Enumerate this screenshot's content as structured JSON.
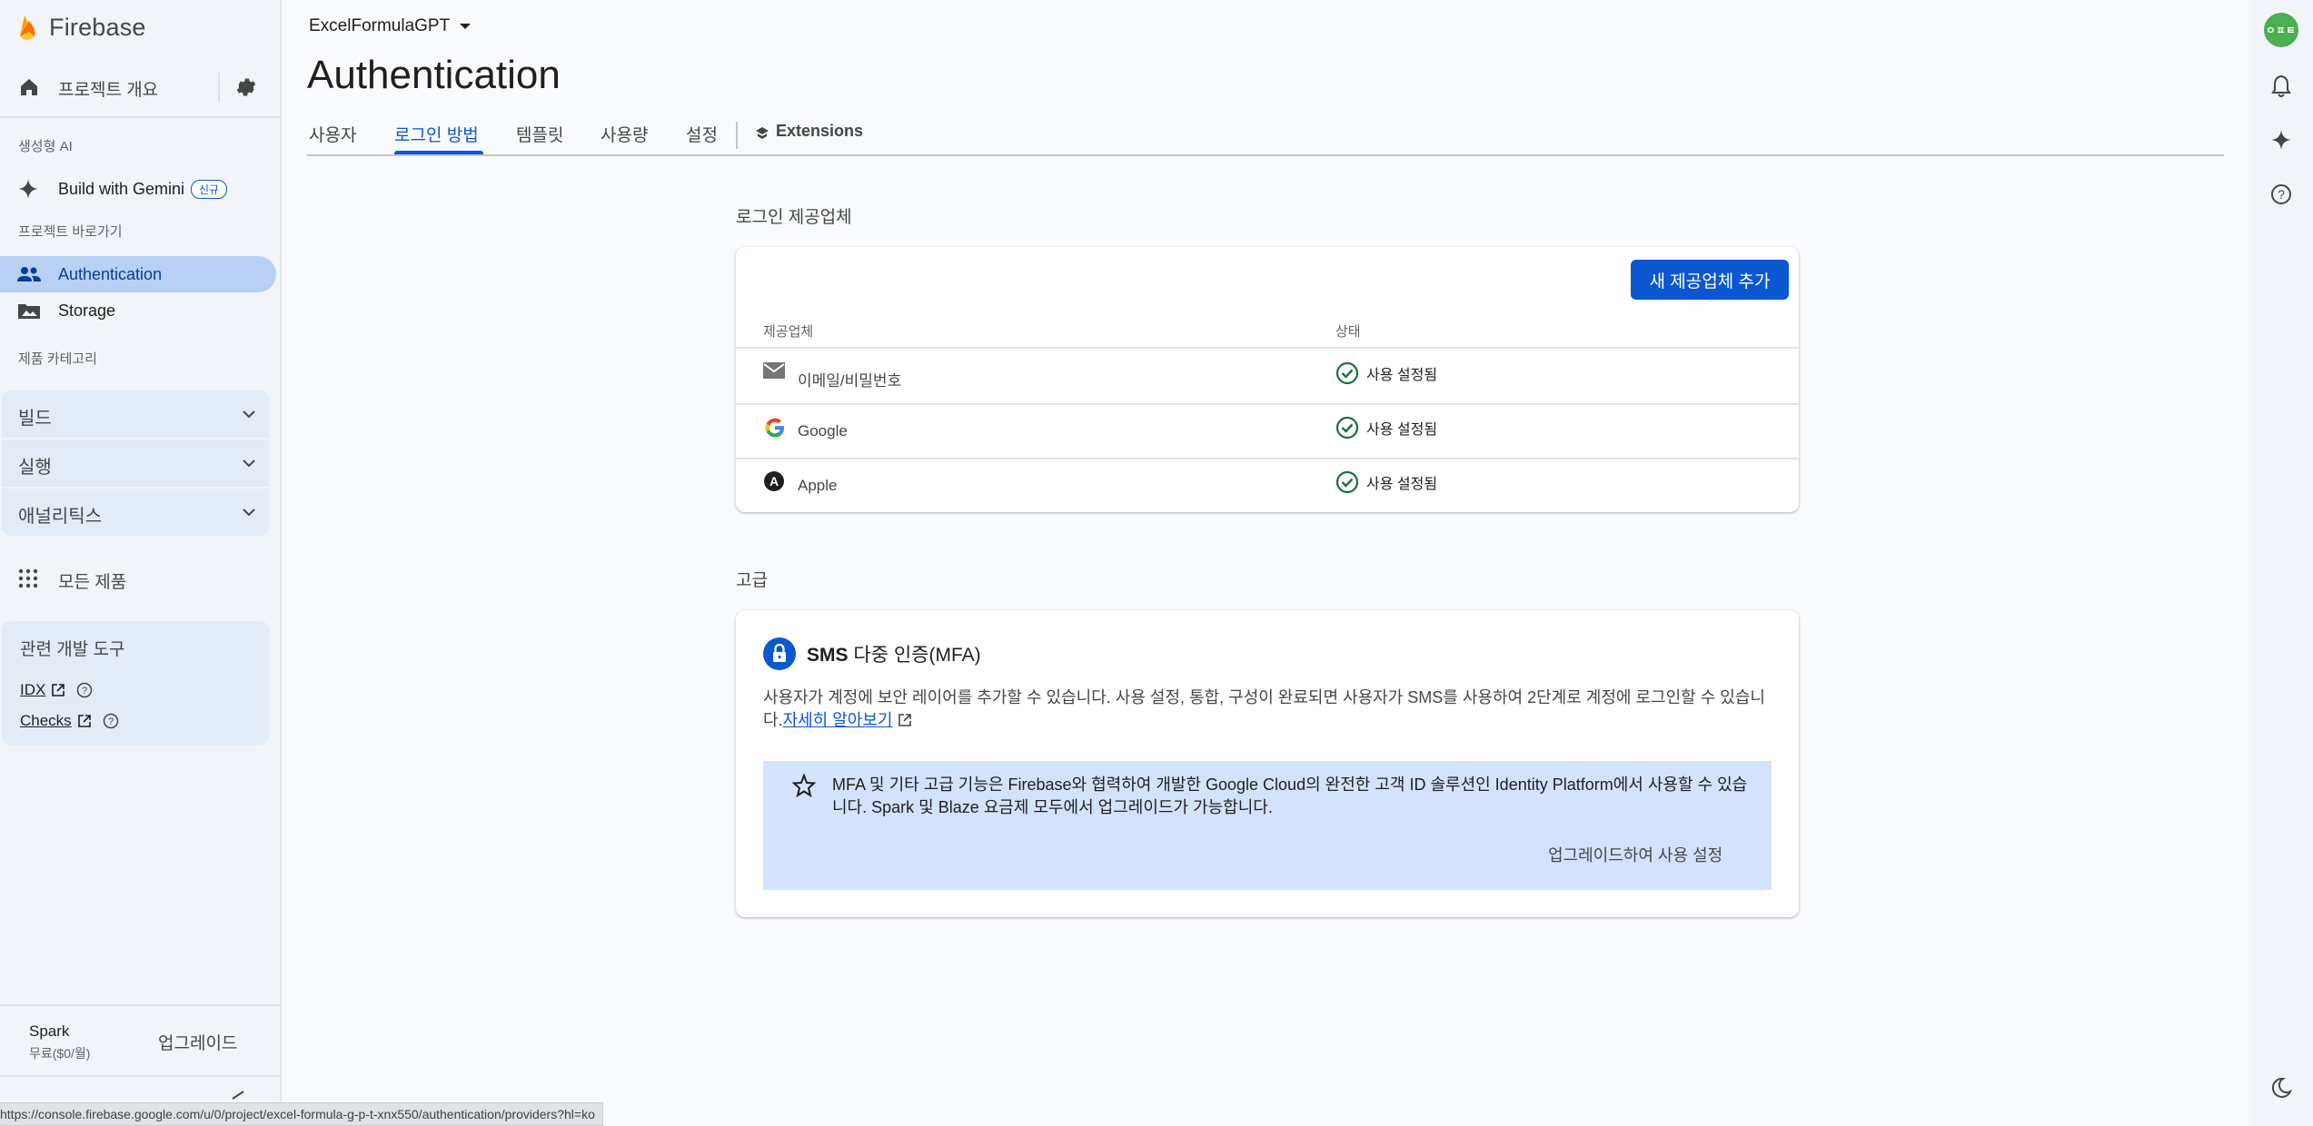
{
  "sidebar": {
    "brand": "Firebase",
    "overview": "프로젝트 개요",
    "section_genai": "생성형 AI",
    "gemini": {
      "label": "Build with Gemini",
      "badge": "신규"
    },
    "section_shortcuts": "프로젝트 바로가기",
    "shortcuts": [
      "Authentication",
      "Storage"
    ],
    "section_categories": "제품 카테고리",
    "categories": [
      "빌드",
      "실행",
      "애널리틱스"
    ],
    "all_products": "모든 제품",
    "devtools": {
      "title": "관련 개발 도구",
      "links": [
        "IDX",
        "Checks"
      ]
    },
    "plan": {
      "name": "Spark",
      "price": "무료($0/월)",
      "upgrade": "업그레이드"
    }
  },
  "header": {
    "project": "ExcelFormulaGPT",
    "title": "Authentication",
    "tabs": [
      "사용자",
      "로그인 방법",
      "템플릿",
      "사용량",
      "설정"
    ],
    "extensions": "Extensions"
  },
  "providers_section": {
    "heading": "로그인 제공업체",
    "add_button": "새 제공업체 추가",
    "col_provider": "제공업체",
    "col_status": "상태",
    "rows": [
      {
        "name": "이메일/비밀번호",
        "status": "사용 설정됨",
        "icon": "mail-icon"
      },
      {
        "name": "Google",
        "status": "사용 설정됨",
        "icon": "google-icon"
      },
      {
        "name": "Apple",
        "status": "사용 설정됨",
        "icon": "apple-icon"
      }
    ]
  },
  "advanced_section": {
    "heading": "고급",
    "mfa_title_bold": "SMS",
    "mfa_title_rest": " 다중 인증(MFA)",
    "description": "사용자가 계정에 보안 레이어를 추가할 수 있습니다. 사용 설정, 통합, 구성이 완료되면 사용자가 SMS를 사용하여 2단계로 계정에 로그인할 수 있습니다.",
    "learn_more": "자세히 알아보기",
    "info_text": "MFA 및 기타 고급 기능은 Firebase와 협력하여 개발한 Google Cloud의 완전한 고객 ID 솔루션인 Identity Platform에서 사용할 수 있습니다. Spark 및 Blaze 요금제 모두에서 업그레이드가 가능합니다.",
    "upgrade_link": "업그레이드하여 사용 설정"
  },
  "rail": {
    "avatar_text": "ㅇㅍㅌ"
  },
  "status_url": "https://console.firebase.google.com/u/0/project/excel-formula-g-p-t-xnx550/authentication/providers?hl=ko",
  "colors": {
    "accent": "#0b57d0",
    "success": "#137333",
    "active_nav": "#b8d0f4",
    "info_box": "#d3e3fd"
  }
}
